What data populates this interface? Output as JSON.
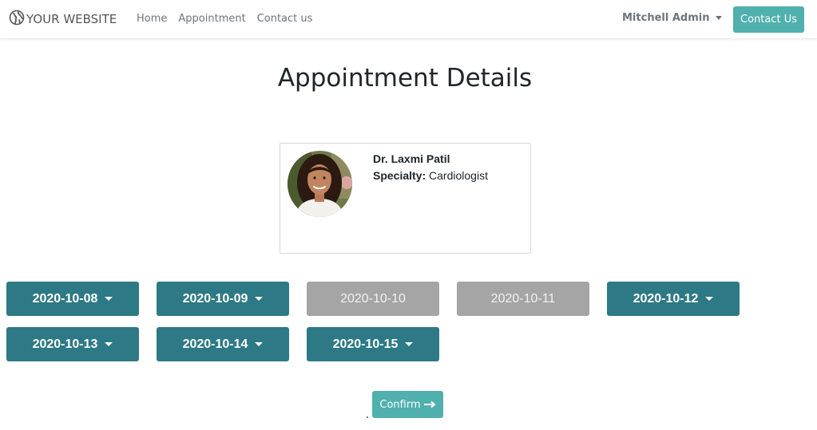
{
  "navbar": {
    "brand": "YOUR WEBSITE",
    "links": [
      "Home",
      "Appointment",
      "Contact us"
    ],
    "user": "Mitchell Admin",
    "contact_button": "Contact Us"
  },
  "page": {
    "title": "Appointment Details"
  },
  "doctor": {
    "name": "Dr. Laxmi Patil",
    "specialty_label": "Specialty:",
    "specialty": "Cardiologist"
  },
  "dates": [
    {
      "label": "2020-10-08",
      "available": true
    },
    {
      "label": "2020-10-09",
      "available": true
    },
    {
      "label": "2020-10-10",
      "available": false
    },
    {
      "label": "2020-10-11",
      "available": false
    },
    {
      "label": "2020-10-12",
      "available": true
    },
    {
      "label": "2020-10-13",
      "available": true
    },
    {
      "label": "2020-10-14",
      "available": true
    },
    {
      "label": "2020-10-15",
      "available": true
    }
  ],
  "actions": {
    "confirm_label": "Confirm"
  },
  "colors": {
    "accent": "#4fb0ae",
    "date_active": "#2d7985",
    "date_disabled": "#a5a5a5"
  },
  "icons": {
    "brand": "globe-icon",
    "user_menu": "caret-down-icon",
    "date_dropdown": "caret-down-icon",
    "confirm": "arrow-right-icon"
  }
}
